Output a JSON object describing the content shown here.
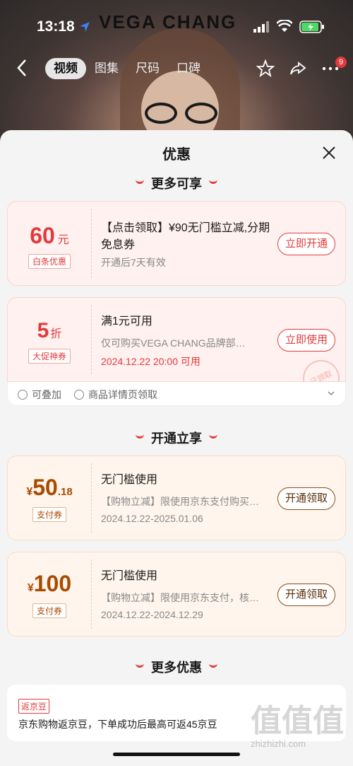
{
  "status": {
    "time": "13:18",
    "brand": "VEGA CHANG"
  },
  "nav": {
    "tabs": [
      "视频",
      "图集",
      "尺码",
      "口碑"
    ],
    "badge": "9"
  },
  "sheet": {
    "title": "优惠",
    "sections": {
      "more": "更多可享",
      "open": "开通立享",
      "more_offers": "更多优惠"
    }
  },
  "cards": [
    {
      "amount": "60",
      "unit": "元",
      "tag": "白条优惠",
      "title": "【点击领取】¥90无门槛立减,分期免息券",
      "desc": "开通后7天有效",
      "button": "立即开通"
    },
    {
      "amount": "5",
      "unit": "折",
      "tag": "大促神券",
      "title": "满1元可用",
      "desc": "仅可购买VEGA CHANG品牌部…",
      "date": "2024.12.22 20:00 可用",
      "button": "立即使用",
      "stamp": "已领取"
    },
    {
      "currency": "¥",
      "amount": "50",
      "decimal": ".18",
      "tag": "支付券",
      "title": "无门槛使用",
      "desc": "【购物立减】限使用京东支付购买…",
      "date": "2024.12.22-2025.01.06",
      "button": "开通领取"
    },
    {
      "currency": "¥",
      "amount": "100",
      "tag": "支付券",
      "title": "无门槛使用",
      "desc": "【购物立减】限使用京东支付，核…",
      "date": "2024.12.22-2024.12.29",
      "button": "开通领取"
    }
  ],
  "card_footer": {
    "stackable": "可叠加",
    "source": "商品详情页领取"
  },
  "bean": {
    "tag": "返京豆",
    "text": "京东购物返京豆，下单成功后最高可返45京豆"
  },
  "watermark": {
    "glyphs": "值值值",
    "site": "zhizhizhi.com"
  },
  "colors": {
    "accent": "#e4393c",
    "orange": "#a84b00"
  }
}
